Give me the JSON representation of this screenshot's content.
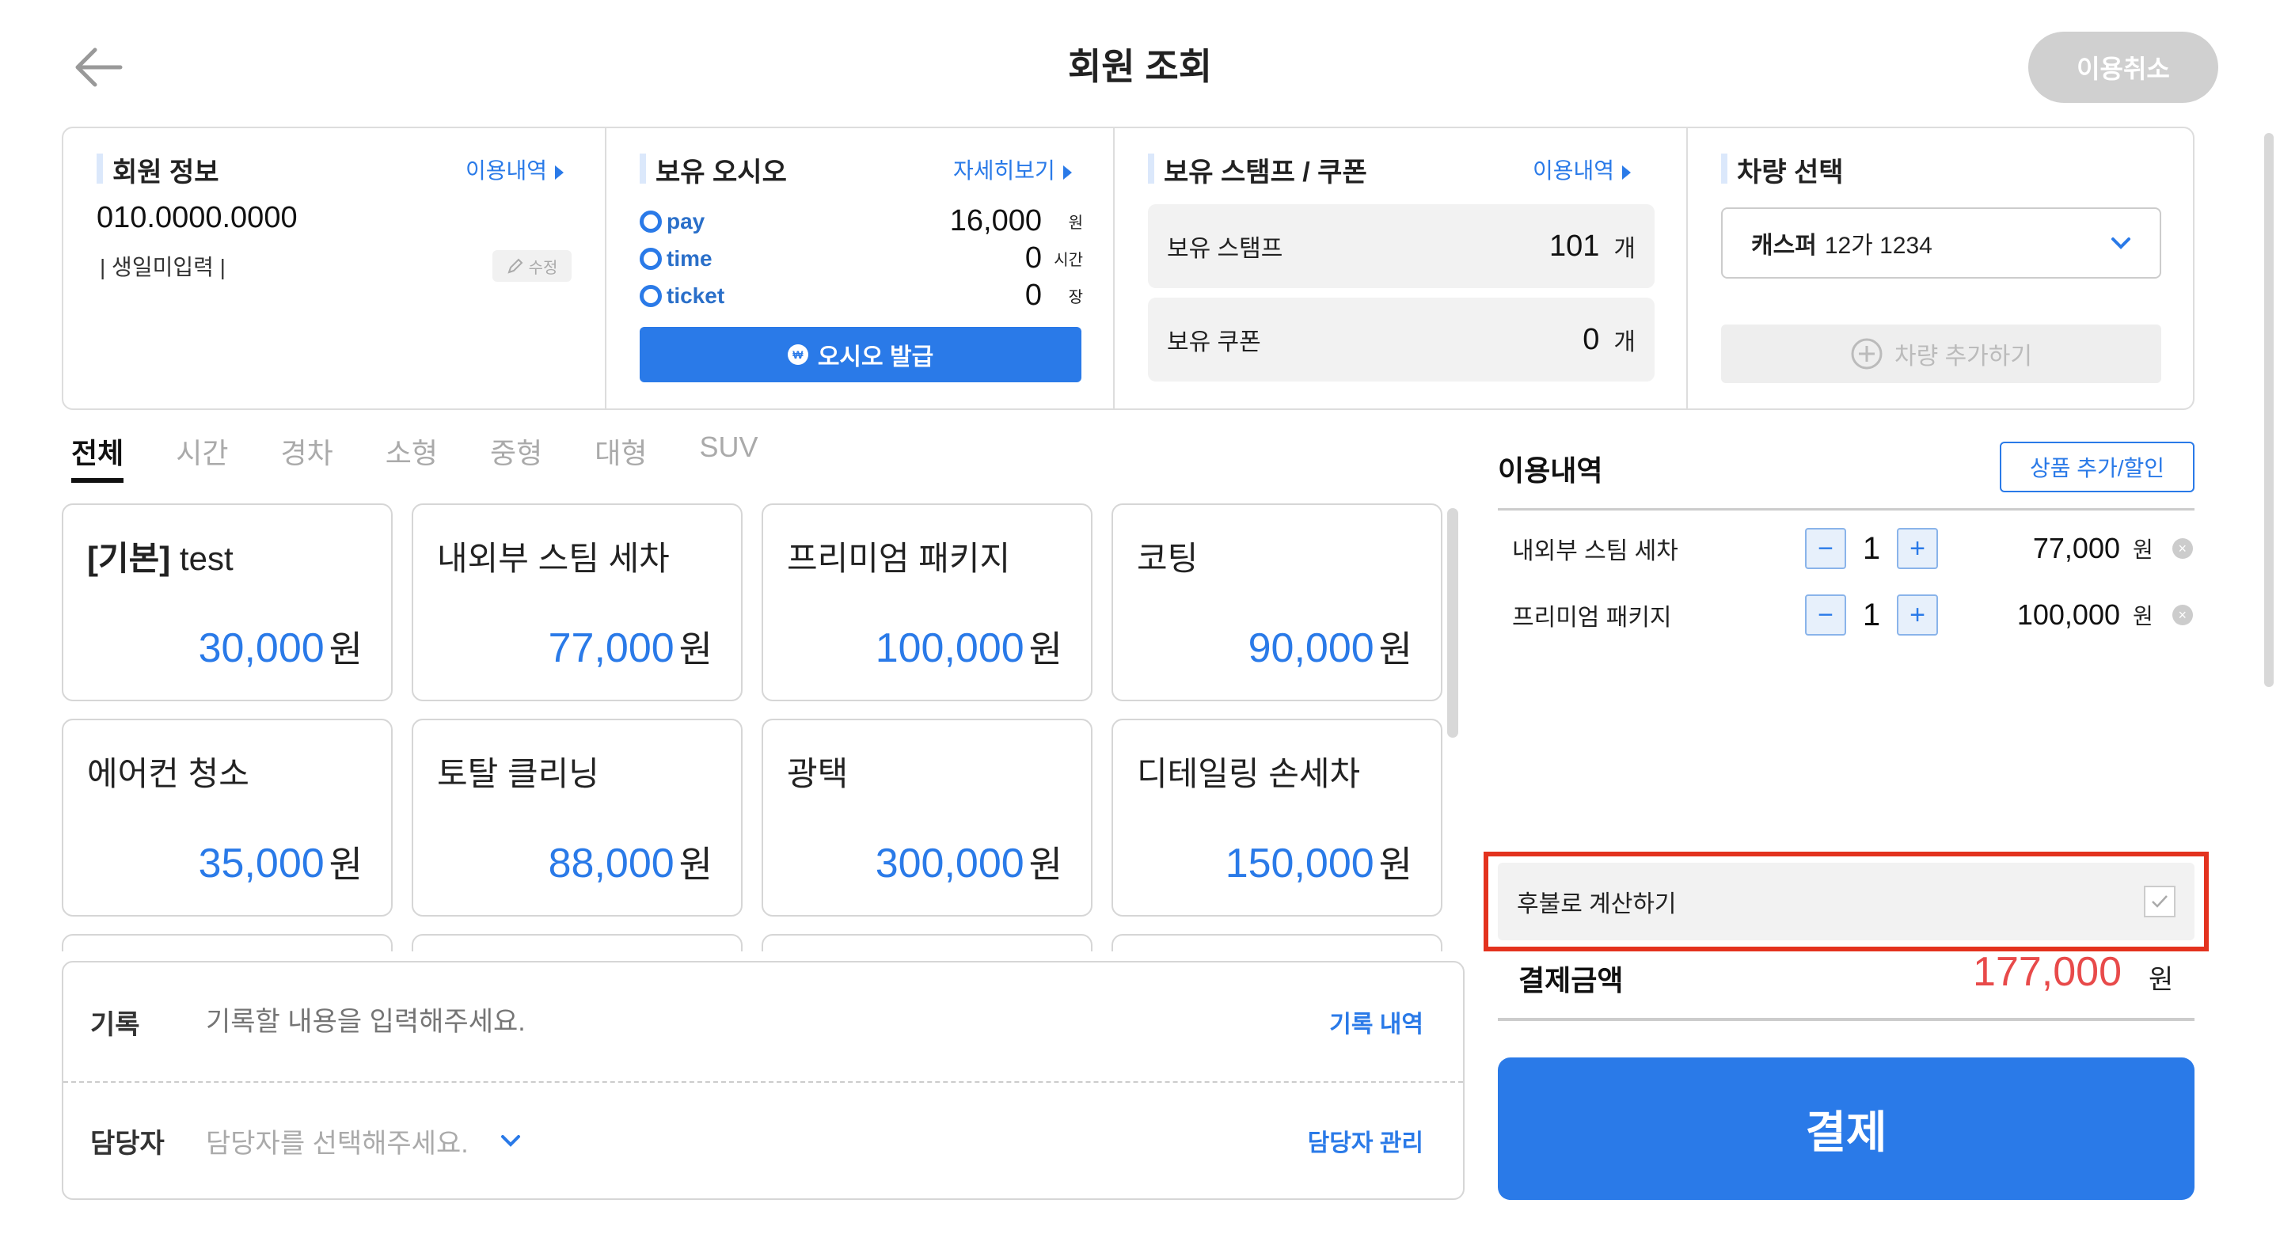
{
  "header": {
    "title": "회원 조회",
    "cancel_label": "이용취소"
  },
  "member": {
    "title": "회원 정보",
    "link": "이용내역",
    "phone": "010.0000.0000",
    "birth": "| 생일미입력 |",
    "edit_label": "수정"
  },
  "osio": {
    "title": "보유 오시오",
    "link": "자세히보기",
    "items": [
      {
        "name": "pay",
        "value": "16,000",
        "unit": "원"
      },
      {
        "name": "time",
        "value": "0",
        "unit": "시간"
      },
      {
        "name": "ticket",
        "value": "0",
        "unit": "장"
      }
    ],
    "issue_label": "오시오 발급",
    "issue_badge": "₩"
  },
  "stamp": {
    "title": "보유 스탬프 / 쿠폰",
    "link": "이용내역",
    "items": [
      {
        "label": "보유 스탬프",
        "value": "101",
        "unit": "개"
      },
      {
        "label": "보유 쿠폰",
        "value": "0",
        "unit": "개"
      }
    ]
  },
  "vehicle": {
    "title": "차량 선택",
    "selected_bold": "캐스퍼",
    "selected_plate": "12가 1234",
    "add_label": "차량 추가하기"
  },
  "tabs": [
    "전체",
    "시간",
    "경차",
    "소형",
    "중형",
    "대형",
    "SUV"
  ],
  "products": [
    {
      "prefix": "[기본]",
      "name": " test",
      "price": "30,000",
      "unit": "원"
    },
    {
      "prefix": "",
      "name": "내외부 스팀 세차",
      "price": "77,000",
      "unit": "원"
    },
    {
      "prefix": "",
      "name": "프리미엄 패키지",
      "price": "100,000",
      "unit": "원"
    },
    {
      "prefix": "",
      "name": "코팅",
      "price": "90,000",
      "unit": "원"
    },
    {
      "prefix": "",
      "name": "에어컨 청소",
      "price": "35,000",
      "unit": "원"
    },
    {
      "prefix": "",
      "name": "토탈 클리닝",
      "price": "88,000",
      "unit": "원"
    },
    {
      "prefix": "",
      "name": "광택",
      "price": "300,000",
      "unit": "원"
    },
    {
      "prefix": "",
      "name": "디테일링 손세차",
      "price": "150,000",
      "unit": "원"
    }
  ],
  "memo": {
    "record_label": "기록",
    "record_placeholder": "기록할 내용을 입력해주세요.",
    "record_link": "기록 내역",
    "staff_label": "담당자",
    "staff_placeholder": "담당자를 선택해주세요.",
    "staff_link": "담당자 관리"
  },
  "usage": {
    "title": "이용내역",
    "add_label": "상품 추가/할인",
    "items": [
      {
        "name": "내외부 스팀 세차",
        "qty": "1",
        "price": "77,000",
        "unit": "원"
      },
      {
        "name": "프리미엄 패키지",
        "qty": "1",
        "price": "100,000",
        "unit": "원"
      }
    ],
    "minus": "−",
    "plus": "+",
    "remove": "×",
    "deferred_label": "후불로 계산하기",
    "deferred_checked": true,
    "total_label": "결제금액",
    "total_value": "177,000",
    "total_unit": "원",
    "pay_label": "결제"
  },
  "colors": {
    "accent": "#2a7ae8",
    "total": "#e84a4a",
    "highlight": "#e3321e"
  }
}
